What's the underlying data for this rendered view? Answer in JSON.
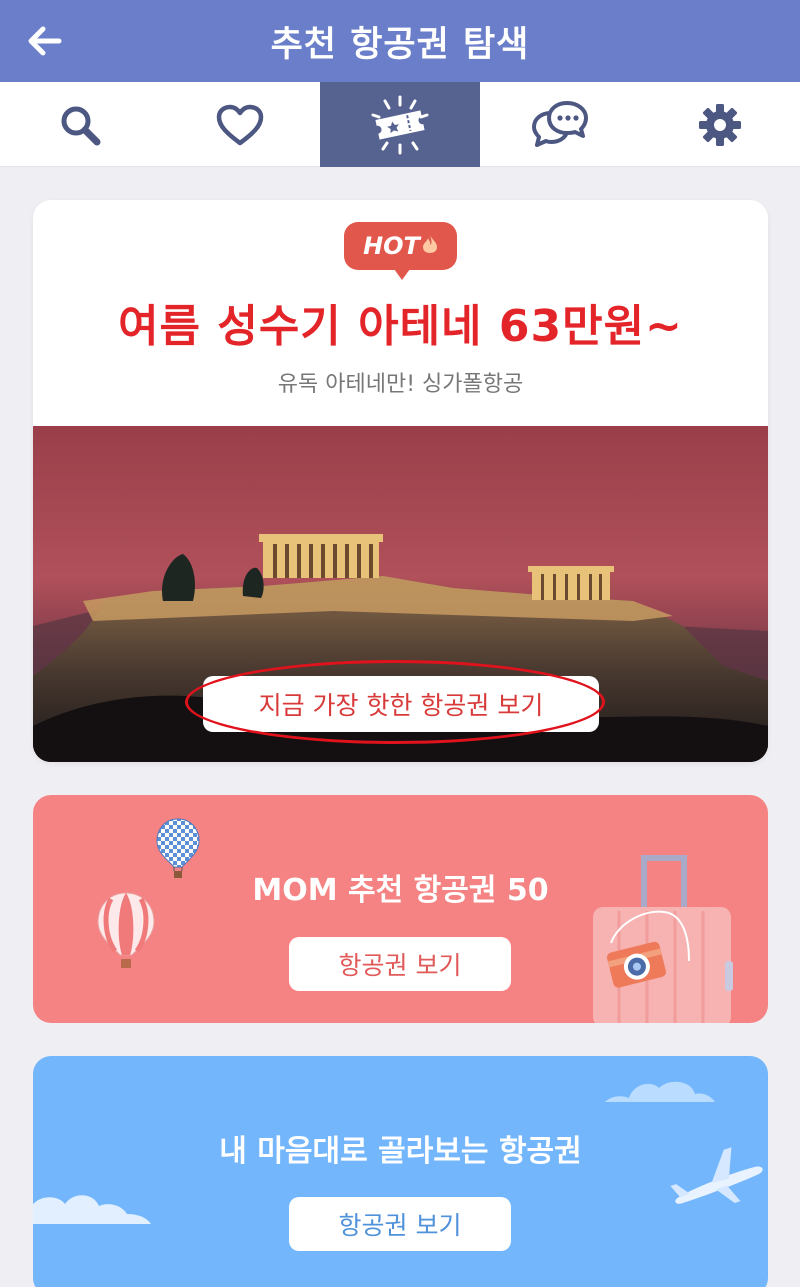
{
  "header": {
    "title": "추천 항공권 탐색",
    "back_icon": "arrow-left-icon",
    "background": "#6b7ec9"
  },
  "tabs": [
    {
      "icon": "search-icon",
      "active": false
    },
    {
      "icon": "heart-icon",
      "active": false
    },
    {
      "icon": "ticket-icon",
      "active": true
    },
    {
      "icon": "chat-bubbles-icon",
      "active": false
    },
    {
      "icon": "gear-icon",
      "active": false
    }
  ],
  "hot_card": {
    "badge": "HOT",
    "badge_icon": "flame-icon",
    "title": "여름 성수기 아테네 63만원~",
    "subtitle": "유독 아테네만! 싱가폴항공",
    "cta": "지금 가장 핫한 항공권 보기",
    "title_color": "#e3252a"
  },
  "mom_card": {
    "title": "MOM 추천 항공권 50",
    "button": "항공권 보기",
    "background": "#f58383"
  },
  "pick_card": {
    "title": "내 마음대로 골라보는 항공권",
    "button": "항공권 보기",
    "background": "#73b6fc"
  }
}
